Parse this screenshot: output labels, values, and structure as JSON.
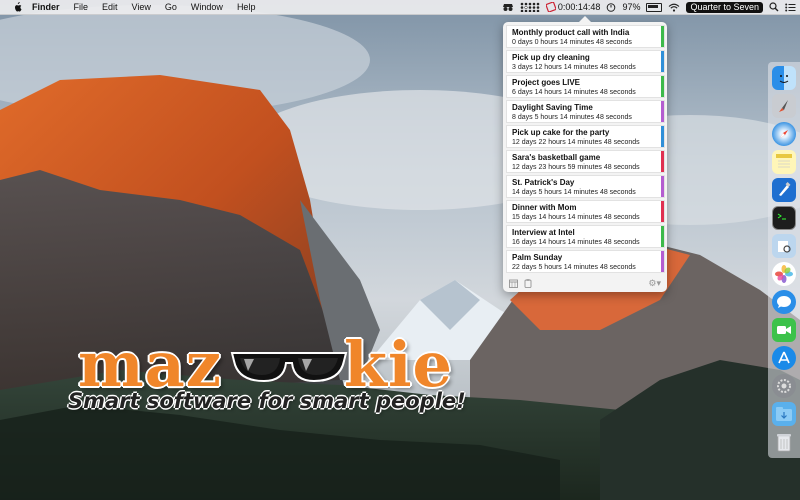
{
  "menubar": {
    "app_name": "Finder",
    "items": [
      "File",
      "Edit",
      "View",
      "Go",
      "Window",
      "Help"
    ],
    "timer": "0:00:14:48",
    "battery": "97%",
    "clock": "Quarter to Seven"
  },
  "popover": {
    "events": [
      {
        "title": "Monthly product call with India",
        "remaining": "0 days 0 hours 14 minutes 48 seconds",
        "color": "#3cb94a"
      },
      {
        "title": "Pick up dry cleaning",
        "remaining": "3 days 12 hours 14 minutes 48 seconds",
        "color": "#2f8fd8"
      },
      {
        "title": "Project goes LIVE",
        "remaining": "6 days 14 hours 14 minutes 48 seconds",
        "color": "#3cb94a"
      },
      {
        "title": "Daylight Saving Time",
        "remaining": "8 days 5 hours 14 minutes 48 seconds",
        "color": "#b45cd0"
      },
      {
        "title": "Pick up cake for the party",
        "remaining": "12 days 22 hours 14 minutes 48 seconds",
        "color": "#2f8fd8"
      },
      {
        "title": "Sara's basketball game",
        "remaining": "12 days 23 hours 59 minutes 48 seconds",
        "color": "#e03050"
      },
      {
        "title": "St. Patrick's Day",
        "remaining": "14 days 5 hours 14 minutes 48 seconds",
        "color": "#b45cd0"
      },
      {
        "title": "Dinner with Mom",
        "remaining": "15 days 14 hours 14 minutes 48 seconds",
        "color": "#e03050"
      },
      {
        "title": "Interview at Intel",
        "remaining": "16 days 14 hours 14 minutes 48 seconds",
        "color": "#3cb94a"
      },
      {
        "title": "Palm Sunday",
        "remaining": "22 days 5 hours 14 minutes 48 seconds",
        "color": "#b45cd0"
      }
    ]
  },
  "logo": {
    "word_left": "maz",
    "word_right": "kie",
    "tagline": "Smart software for smart people!"
  },
  "dock": {
    "icons": [
      "finder-icon",
      "launchpad-icon",
      "safari-icon",
      "notes-icon",
      "xcode-icon",
      "terminal-icon",
      "preview-icon",
      "photos-icon",
      "messages-icon",
      "facetime-icon",
      "app-store-icon",
      "system-preferences-icon",
      "downloads-folder-icon",
      "trash-icon"
    ]
  }
}
